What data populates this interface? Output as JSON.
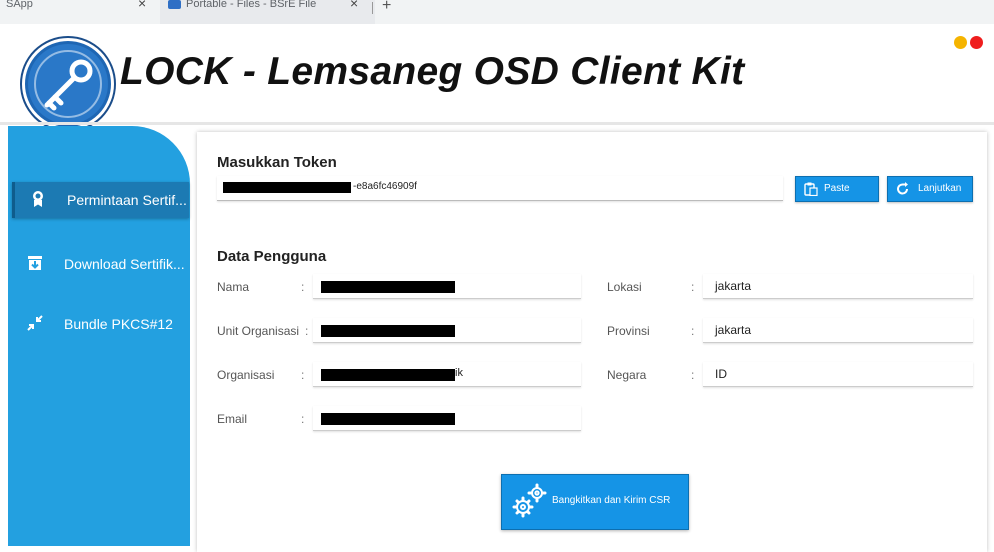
{
  "browser": {
    "tabs": [
      {
        "title": "SApp",
        "close": "×"
      },
      {
        "title": "Portable - Files - BSrE File",
        "close": "×"
      }
    ],
    "new_tab": "+"
  },
  "app": {
    "title": "LOCK - Lemsaneg OSD Client Kit"
  },
  "sidebar": {
    "items": [
      {
        "label": "Permintaan Sertif...",
        "icon": "certificate-icon"
      },
      {
        "label": "Download Sertifik...",
        "icon": "download-box-icon"
      },
      {
        "label": "Bundle PKCS#12",
        "icon": "compress-arrows-icon"
      }
    ]
  },
  "token": {
    "title": "Masukkan Token",
    "value_suffix": "-e8a6fc46909f",
    "paste_label": "Paste",
    "continue_label": "Lanjutkan"
  },
  "user": {
    "title": "Data Pengguna",
    "left_fields": [
      {
        "label": "Nama",
        "colon": ":",
        "tail": ""
      },
      {
        "label": "Unit Organisasi",
        "colon": ":",
        "tail": ""
      },
      {
        "label": "Organisasi",
        "colon": ":",
        "tail": "ik"
      },
      {
        "label": "Email",
        "colon": ":",
        "tail": ""
      }
    ],
    "right_fields": [
      {
        "label": "Lokasi",
        "colon": ":",
        "value": "jakarta"
      },
      {
        "label": "Provinsi",
        "colon": ":",
        "value": "jakarta"
      },
      {
        "label": "Negara",
        "colon": ":",
        "value": "ID"
      }
    ]
  },
  "csr_button": {
    "label": "Bangkitkan dan Kirim CSR"
  },
  "colors": {
    "sidebar": "#23a0e0",
    "button": "#1594e6",
    "dot_yellow": "#f5b400",
    "dot_red": "#ef1d1d"
  }
}
